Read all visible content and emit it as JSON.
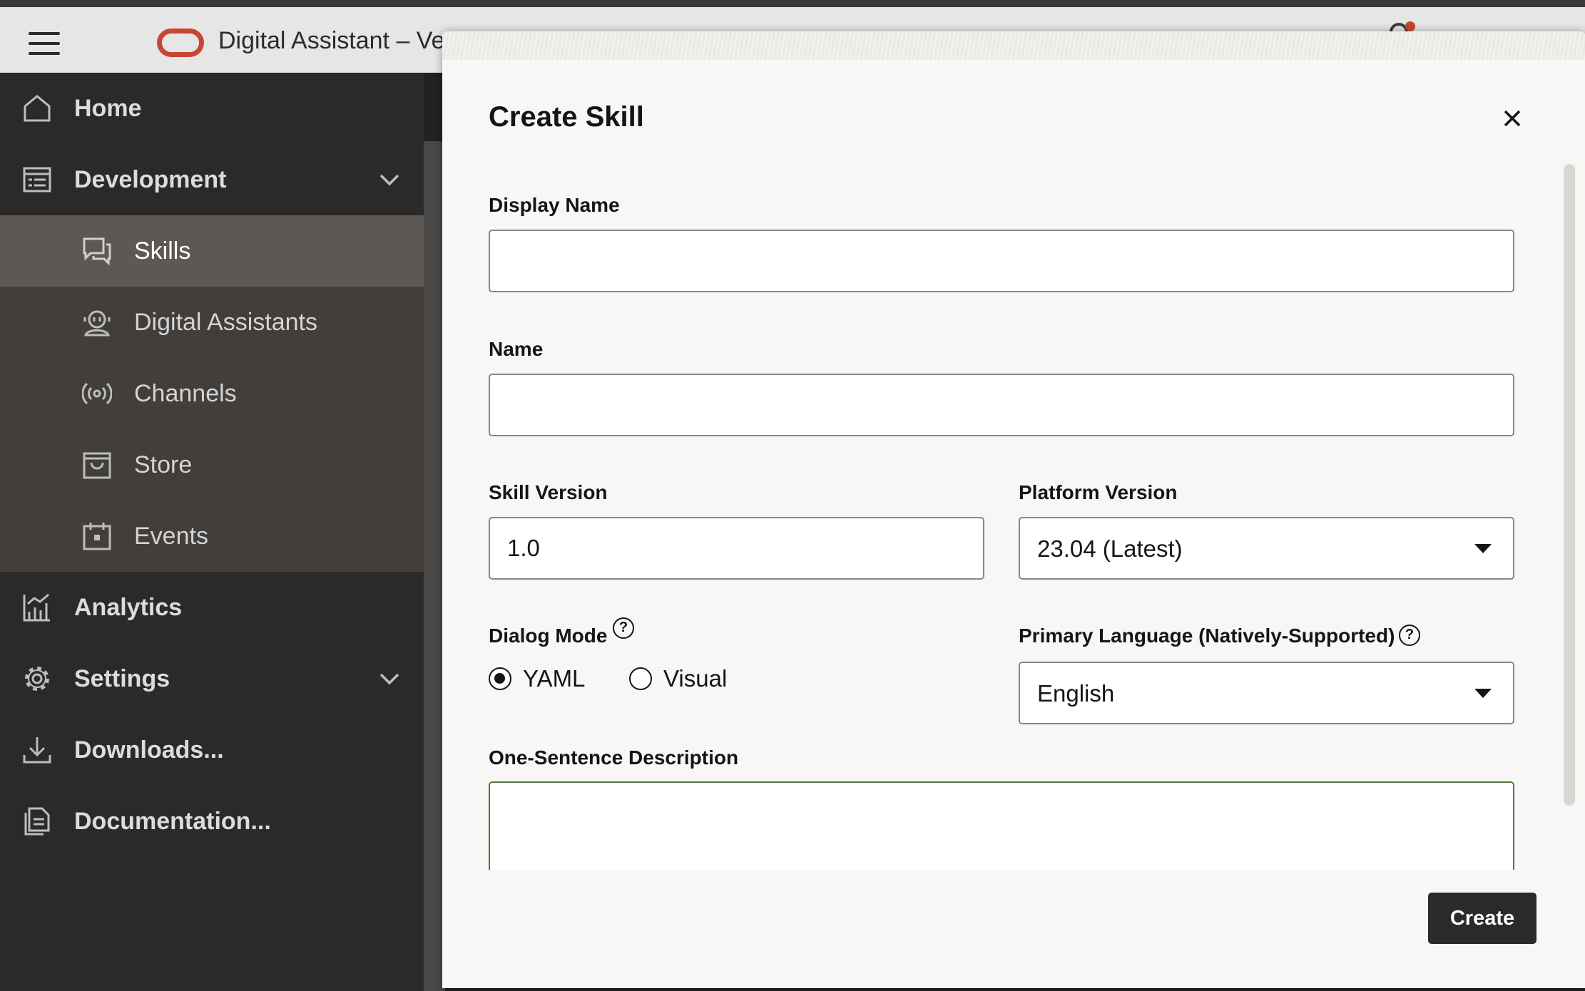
{
  "header": {
    "app_title": "Digital Assistant – Ver",
    "menu_icon": "hamburger-icon",
    "logo": "oracle-logo",
    "notification_icon": "bell-icon"
  },
  "sidebar": {
    "items": [
      {
        "label": "Home",
        "icon": "home-icon"
      },
      {
        "label": "Development",
        "icon": "development-icon",
        "expanded": true
      },
      {
        "label": "Skills",
        "icon": "skills-icon",
        "selected": true
      },
      {
        "label": "Digital Assistants",
        "icon": "digital-assistant-icon"
      },
      {
        "label": "Channels",
        "icon": "channels-icon"
      },
      {
        "label": "Store",
        "icon": "store-icon"
      },
      {
        "label": "Events",
        "icon": "events-icon"
      },
      {
        "label": "Analytics",
        "icon": "analytics-icon"
      },
      {
        "label": "Settings",
        "icon": "settings-icon",
        "expanded": false
      },
      {
        "label": "Downloads...",
        "icon": "download-icon"
      },
      {
        "label": "Documentation...",
        "icon": "documentation-icon"
      }
    ]
  },
  "dialog": {
    "title": "Create Skill",
    "display_name": {
      "label": "Display Name",
      "value": ""
    },
    "name": {
      "label": "Name",
      "value": ""
    },
    "skill_version": {
      "label": "Skill Version",
      "value": "1.0"
    },
    "platform_version": {
      "label": "Platform Version",
      "value": "23.04 (Latest)"
    },
    "dialog_mode": {
      "label": "Dialog Mode",
      "options": [
        {
          "label": "YAML",
          "checked": true
        },
        {
          "label": "Visual",
          "checked": false
        }
      ]
    },
    "primary_language": {
      "label": "Primary Language (Natively-Supported)",
      "value": "English"
    },
    "description": {
      "label": "One-Sentence Description",
      "value": ""
    },
    "create_label": "Create",
    "help_glyph": "?"
  },
  "colors": {
    "sidebar_bg": "#2c2a28",
    "sidebar_sub_bg": "#413e3b",
    "selected_bg": "#5b5855",
    "brand_red": "#c74634",
    "focus_green": "#4f7d3c",
    "primary_button": "#2c2a28"
  }
}
